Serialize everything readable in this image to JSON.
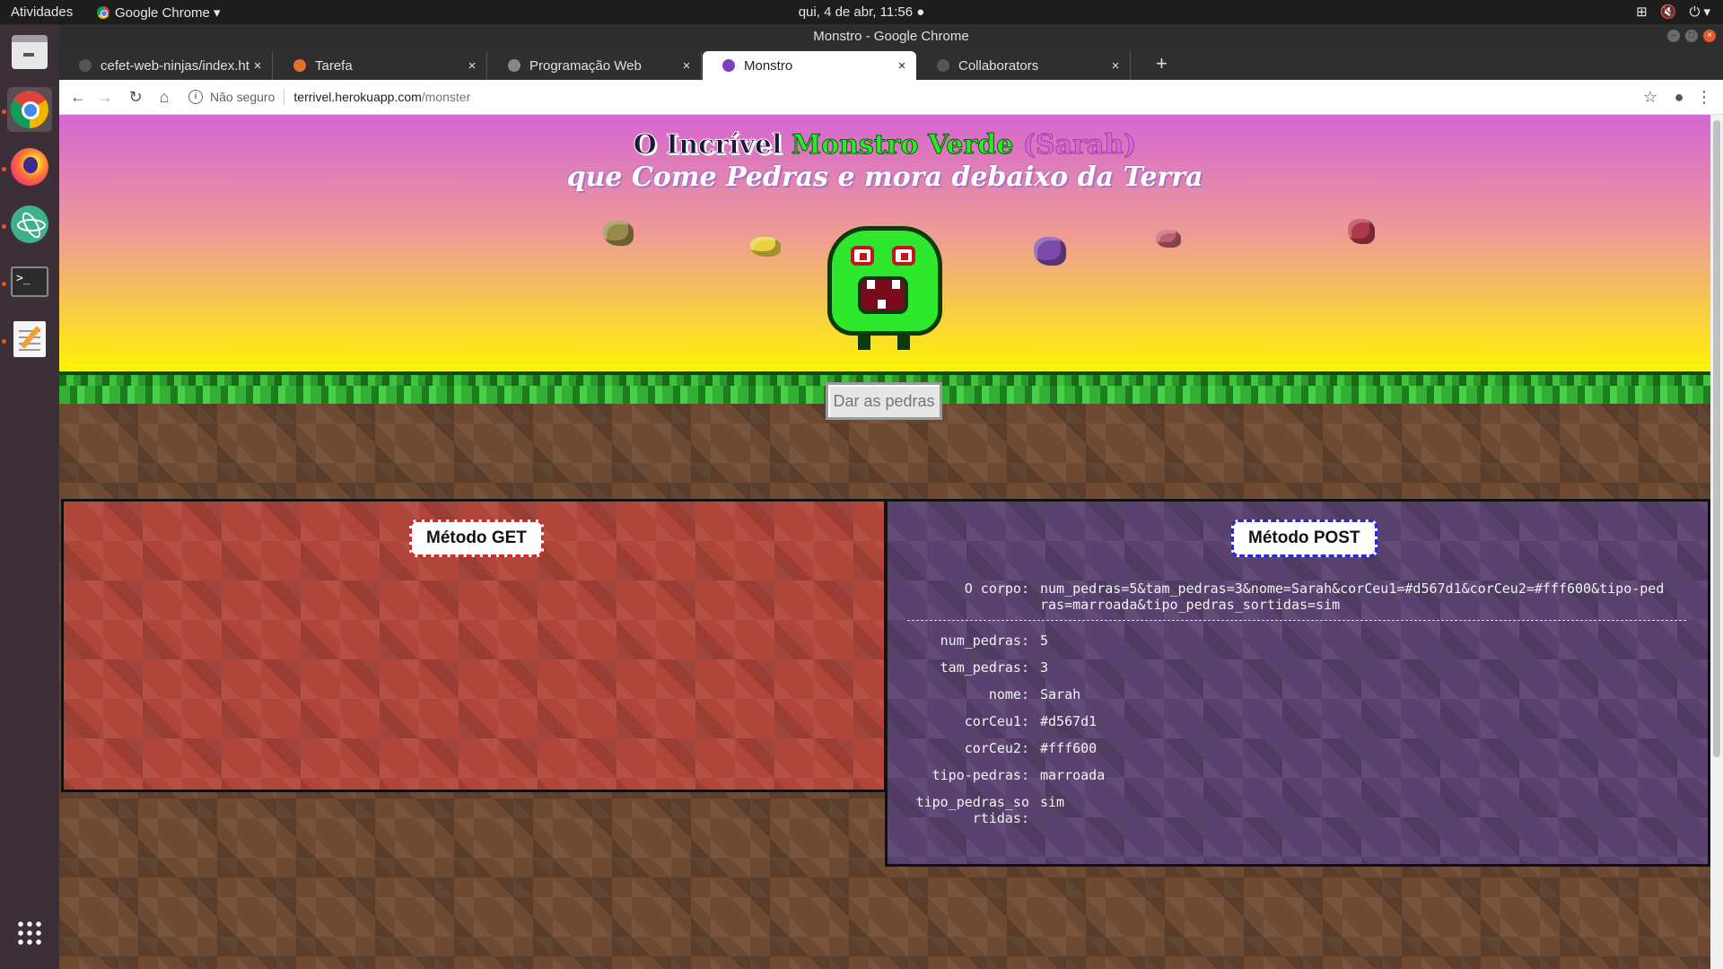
{
  "topbar": {
    "activities": "Atividades",
    "app_menu": "Google Chrome ▾",
    "clock": "qui,  4 de abr, 11:56 ●",
    "tray": [
      "⊞",
      "🔇",
      "⏻ ▾"
    ]
  },
  "dock": {
    "items": [
      "files-icon",
      "chrome-icon",
      "firefox-icon",
      "atom-icon",
      "terminal-icon",
      "text-editor-icon",
      "app-grid-icon"
    ],
    "terminal_glyph": ">_"
  },
  "window": {
    "title": "Monstro - Google Chrome"
  },
  "tabs": [
    {
      "label": "cefet-web-ninjas/index.ht",
      "close": "×",
      "favicon_color": "#333333"
    },
    {
      "label": "Tarefa",
      "close": "×",
      "favicon_color": "#e07030"
    },
    {
      "label": "Programação Web",
      "close": "×",
      "favicon_color": "#888888"
    },
    {
      "label": "Monstro",
      "close": "×",
      "favicon_color": "#7b3fc0"
    },
    {
      "label": "Collaborators",
      "close": "×",
      "favicon_color": "#333333"
    }
  ],
  "new_tab": "+",
  "toolbar": {
    "back": "←",
    "forward": "→",
    "reload": "↻",
    "home": "⌂",
    "info": "i",
    "security": "Não seguro",
    "url_host": "terrivel.herokuapp.com",
    "url_path": "/monster",
    "star": "☆",
    "profile": "●",
    "menu": "⋮"
  },
  "page": {
    "title": {
      "part1": "O Incrível ",
      "part2": "Monstro Verde",
      "part3": " (Sarah)",
      "line2": "que Come Pedras e mora debaixo da Terra"
    },
    "button": "Dar as pedras",
    "get_panel": {
      "title": "Método GET"
    },
    "post_panel": {
      "title": "Método POST",
      "body_label": "O corpo:",
      "body_value": "num_pedras=5&tam_pedras=3&nome=Sarah&corCeu1=#d567d1&corCeu2=#fff600&tipo-pedras=marroada&tipo_pedras_sortidas=sim",
      "fields": [
        {
          "key": "num_pedras:",
          "value": "5"
        },
        {
          "key": "tam_pedras:",
          "value": "3"
        },
        {
          "key": "nome:",
          "value": "Sarah"
        },
        {
          "key": "corCeu1:",
          "value": "#d567d1"
        },
        {
          "key": "corCeu2:",
          "value": "#fff600"
        },
        {
          "key": "tipo-pedras:",
          "value": "marroada"
        },
        {
          "key": "tipo_pedras_sortidas:",
          "value": "sim"
        }
      ]
    },
    "sky_colors": [
      "#d567d1",
      "#fff600"
    ],
    "rock_colors": [
      "#9a8a4a",
      "#e8d040",
      "#7a4aa8",
      "#c06070",
      "#b03a4a"
    ]
  }
}
